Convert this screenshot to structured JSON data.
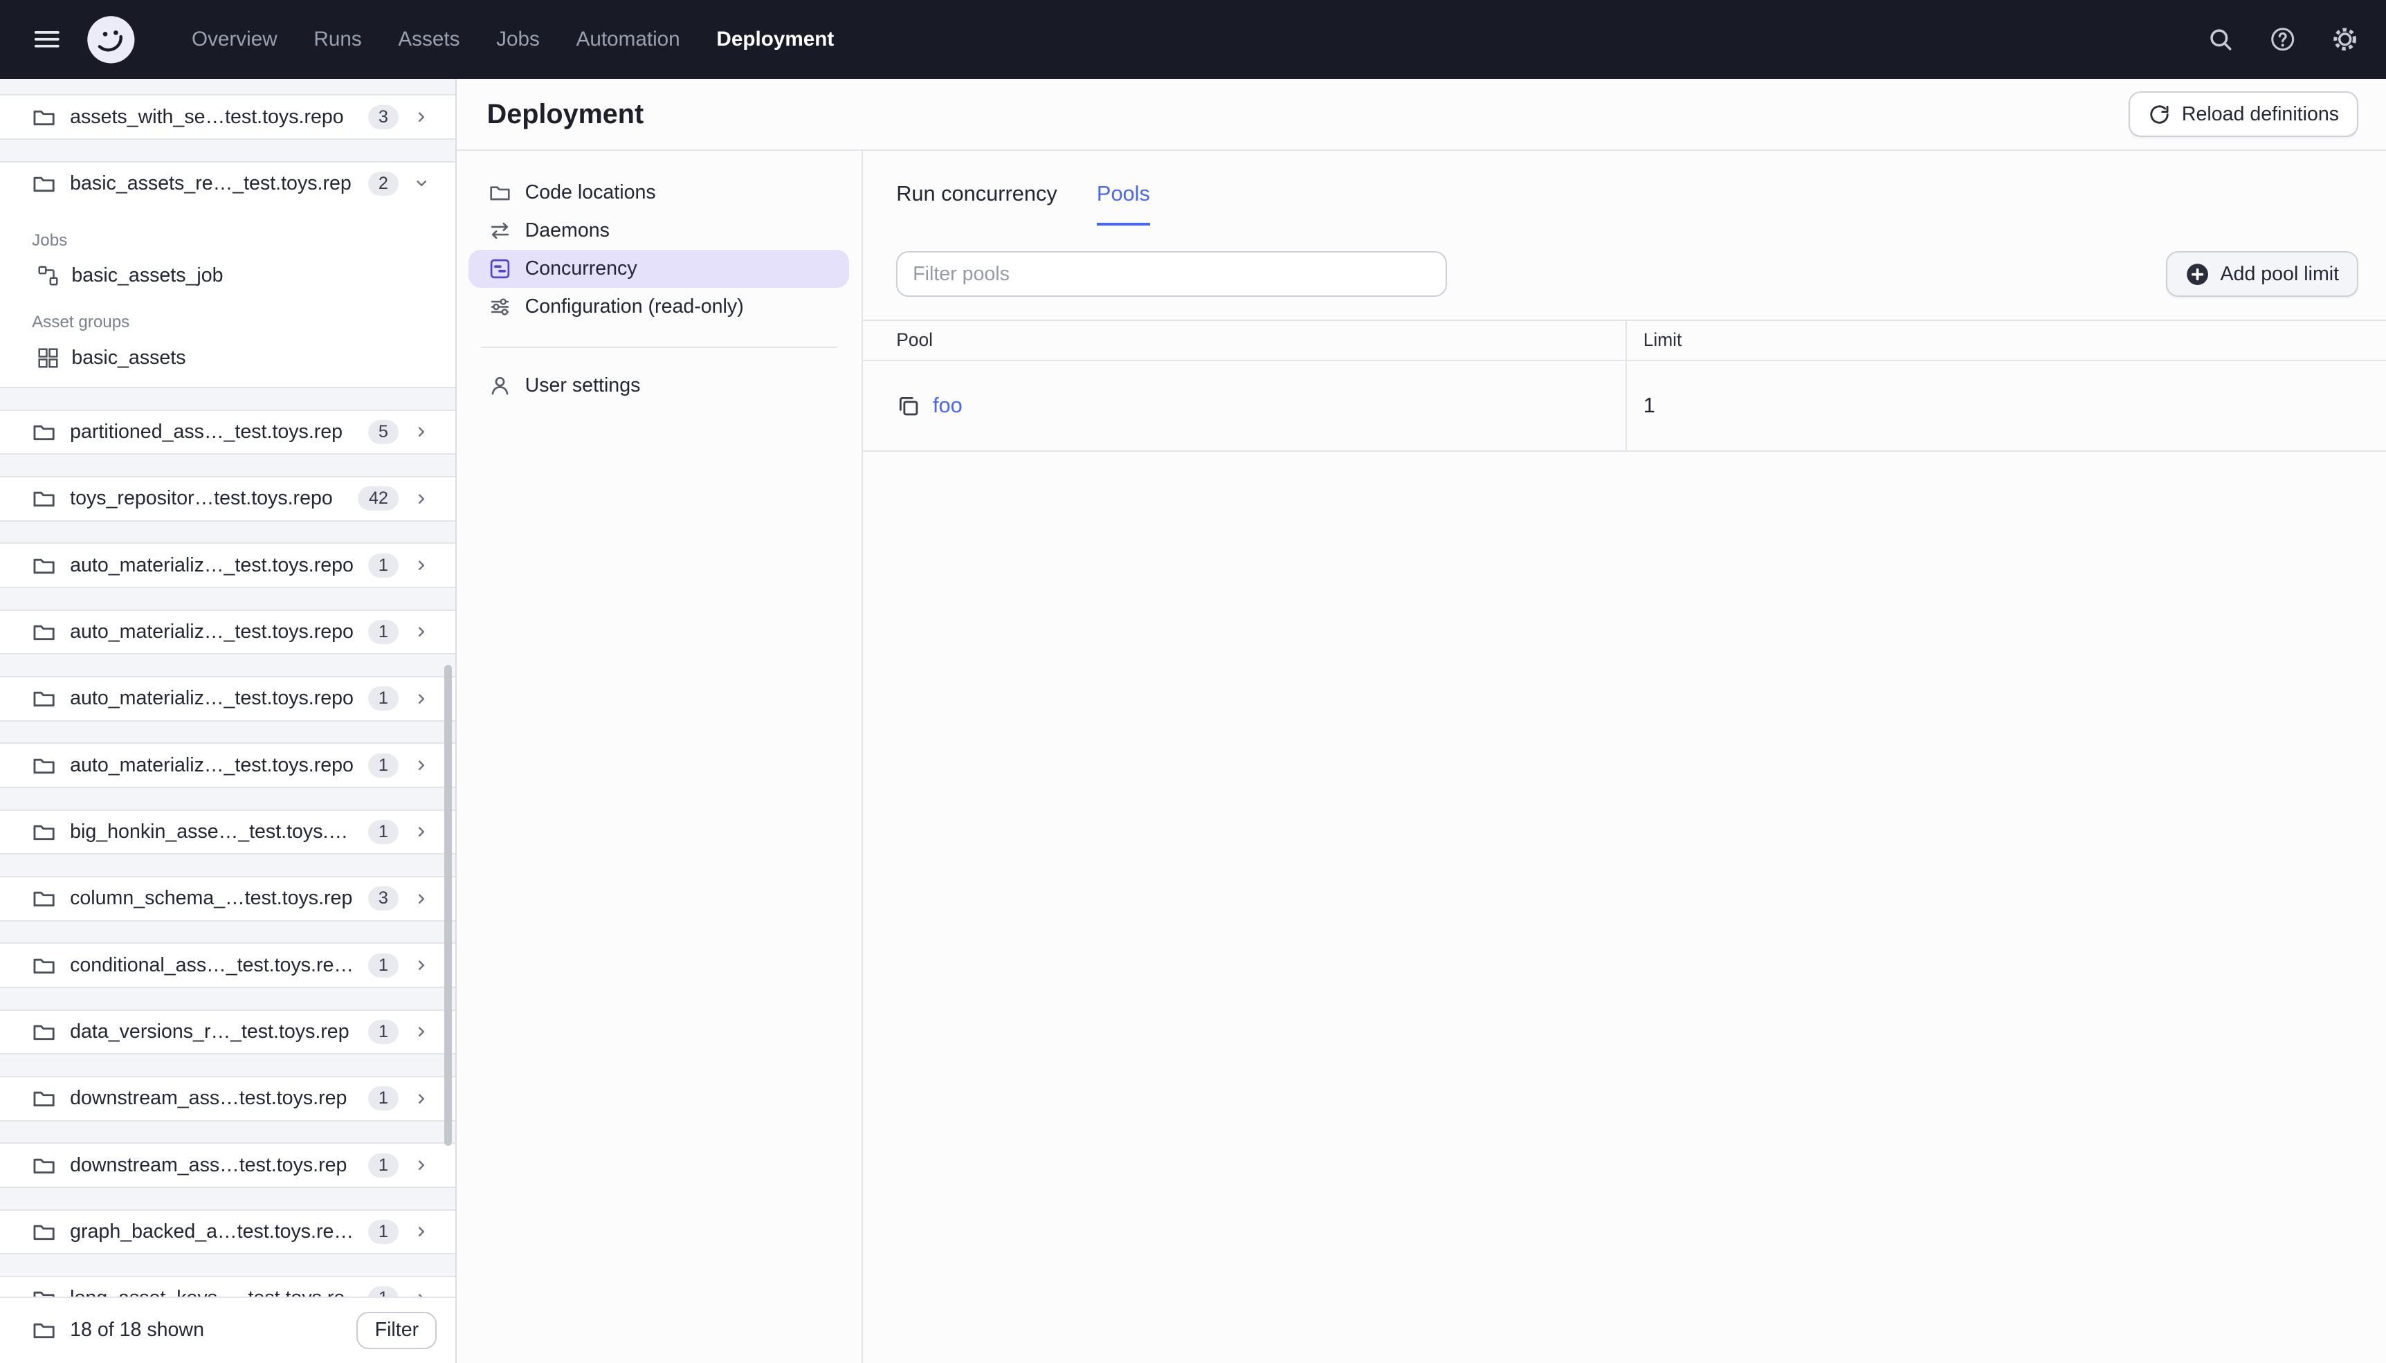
{
  "topnav": {
    "items": [
      "Overview",
      "Runs",
      "Assets",
      "Jobs",
      "Automation",
      "Deployment"
    ],
    "active": "Deployment"
  },
  "sidebar": {
    "sections": [
      {
        "name": "assets_with_se…test.toys.repo",
        "badge": "3"
      },
      {
        "name": "basic_assets_re…_test.toys.rep",
        "badge": "2",
        "expanded": true,
        "jobs_label": "Jobs",
        "job_name": "basic_assets_job",
        "groups_label": "Asset groups",
        "group_name": "basic_assets"
      },
      {
        "name": "partitioned_ass…_test.toys.rep",
        "badge": "5"
      },
      {
        "name": "toys_repositor…test.toys.repo",
        "badge": "42"
      },
      {
        "name": "auto_materializ…_test.toys.repo",
        "badge": "1"
      },
      {
        "name": "auto_materializ…_test.toys.repo",
        "badge": "1"
      },
      {
        "name": "auto_materializ…_test.toys.repo",
        "badge": "1"
      },
      {
        "name": "auto_materializ…_test.toys.repo",
        "badge": "1"
      },
      {
        "name": "big_honkin_asse…_test.toys.rep",
        "badge": "1"
      },
      {
        "name": "column_schema_…test.toys.rep",
        "badge": "3"
      },
      {
        "name": "conditional_ass…_test.toys.repo",
        "badge": "1"
      },
      {
        "name": "data_versions_r…_test.toys.rep",
        "badge": "1"
      },
      {
        "name": "downstream_ass…test.toys.rep",
        "badge": "1"
      },
      {
        "name": "downstream_ass…test.toys.rep",
        "badge": "1"
      },
      {
        "name": "graph_backed_a…test.toys.repo",
        "badge": "1"
      },
      {
        "name": "long_asset_keys…_test.toys.re",
        "badge": "1"
      }
    ],
    "footer": {
      "count": "18 of 18 shown",
      "filter_label": "Filter"
    }
  },
  "deployment": {
    "title": "Deployment",
    "reload_label": "Reload definitions",
    "subnav": [
      "Code locations",
      "Daemons",
      "Concurrency",
      "Configuration (read-only)"
    ],
    "selected_subnav": "Concurrency",
    "user_settings": "User settings",
    "tabs": [
      "Run concurrency",
      "Pools"
    ],
    "active_tab": "Pools",
    "filter_placeholder": "Filter pools",
    "add_pool_label": "Add pool limit",
    "table": {
      "columns": [
        "Pool",
        "Limit"
      ],
      "rows": [
        {
          "pool": "foo",
          "limit": "1"
        }
      ]
    }
  },
  "icons": {
    "menu": "hamburger",
    "logo": "dagster-octopus",
    "search": "magnifier",
    "help": "question-circle",
    "settings": "gear",
    "code_location": "folder",
    "chevron_collapsed": "chevron-right",
    "chevron_expanded": "chevron-down",
    "job": "graph-nodes",
    "asset_group": "grid",
    "daemons": "swap-arrows",
    "concurrency": "gantt-square",
    "configuration": "sliders",
    "user_settings": "person",
    "pool": "stacked-copies",
    "reload": "refresh-arrow",
    "add": "plus-circle"
  },
  "colors": {
    "nav_bg": "#181A26",
    "accent": "#4666FF",
    "accent_purple": "#4F43DD",
    "selected_bg": "#E6E1FB",
    "badge_bg": "#E9EAF0",
    "border": "#E4E5EA",
    "sidebar_bg": "#F4F5F8",
    "main_bg": "#FCFCFD"
  }
}
